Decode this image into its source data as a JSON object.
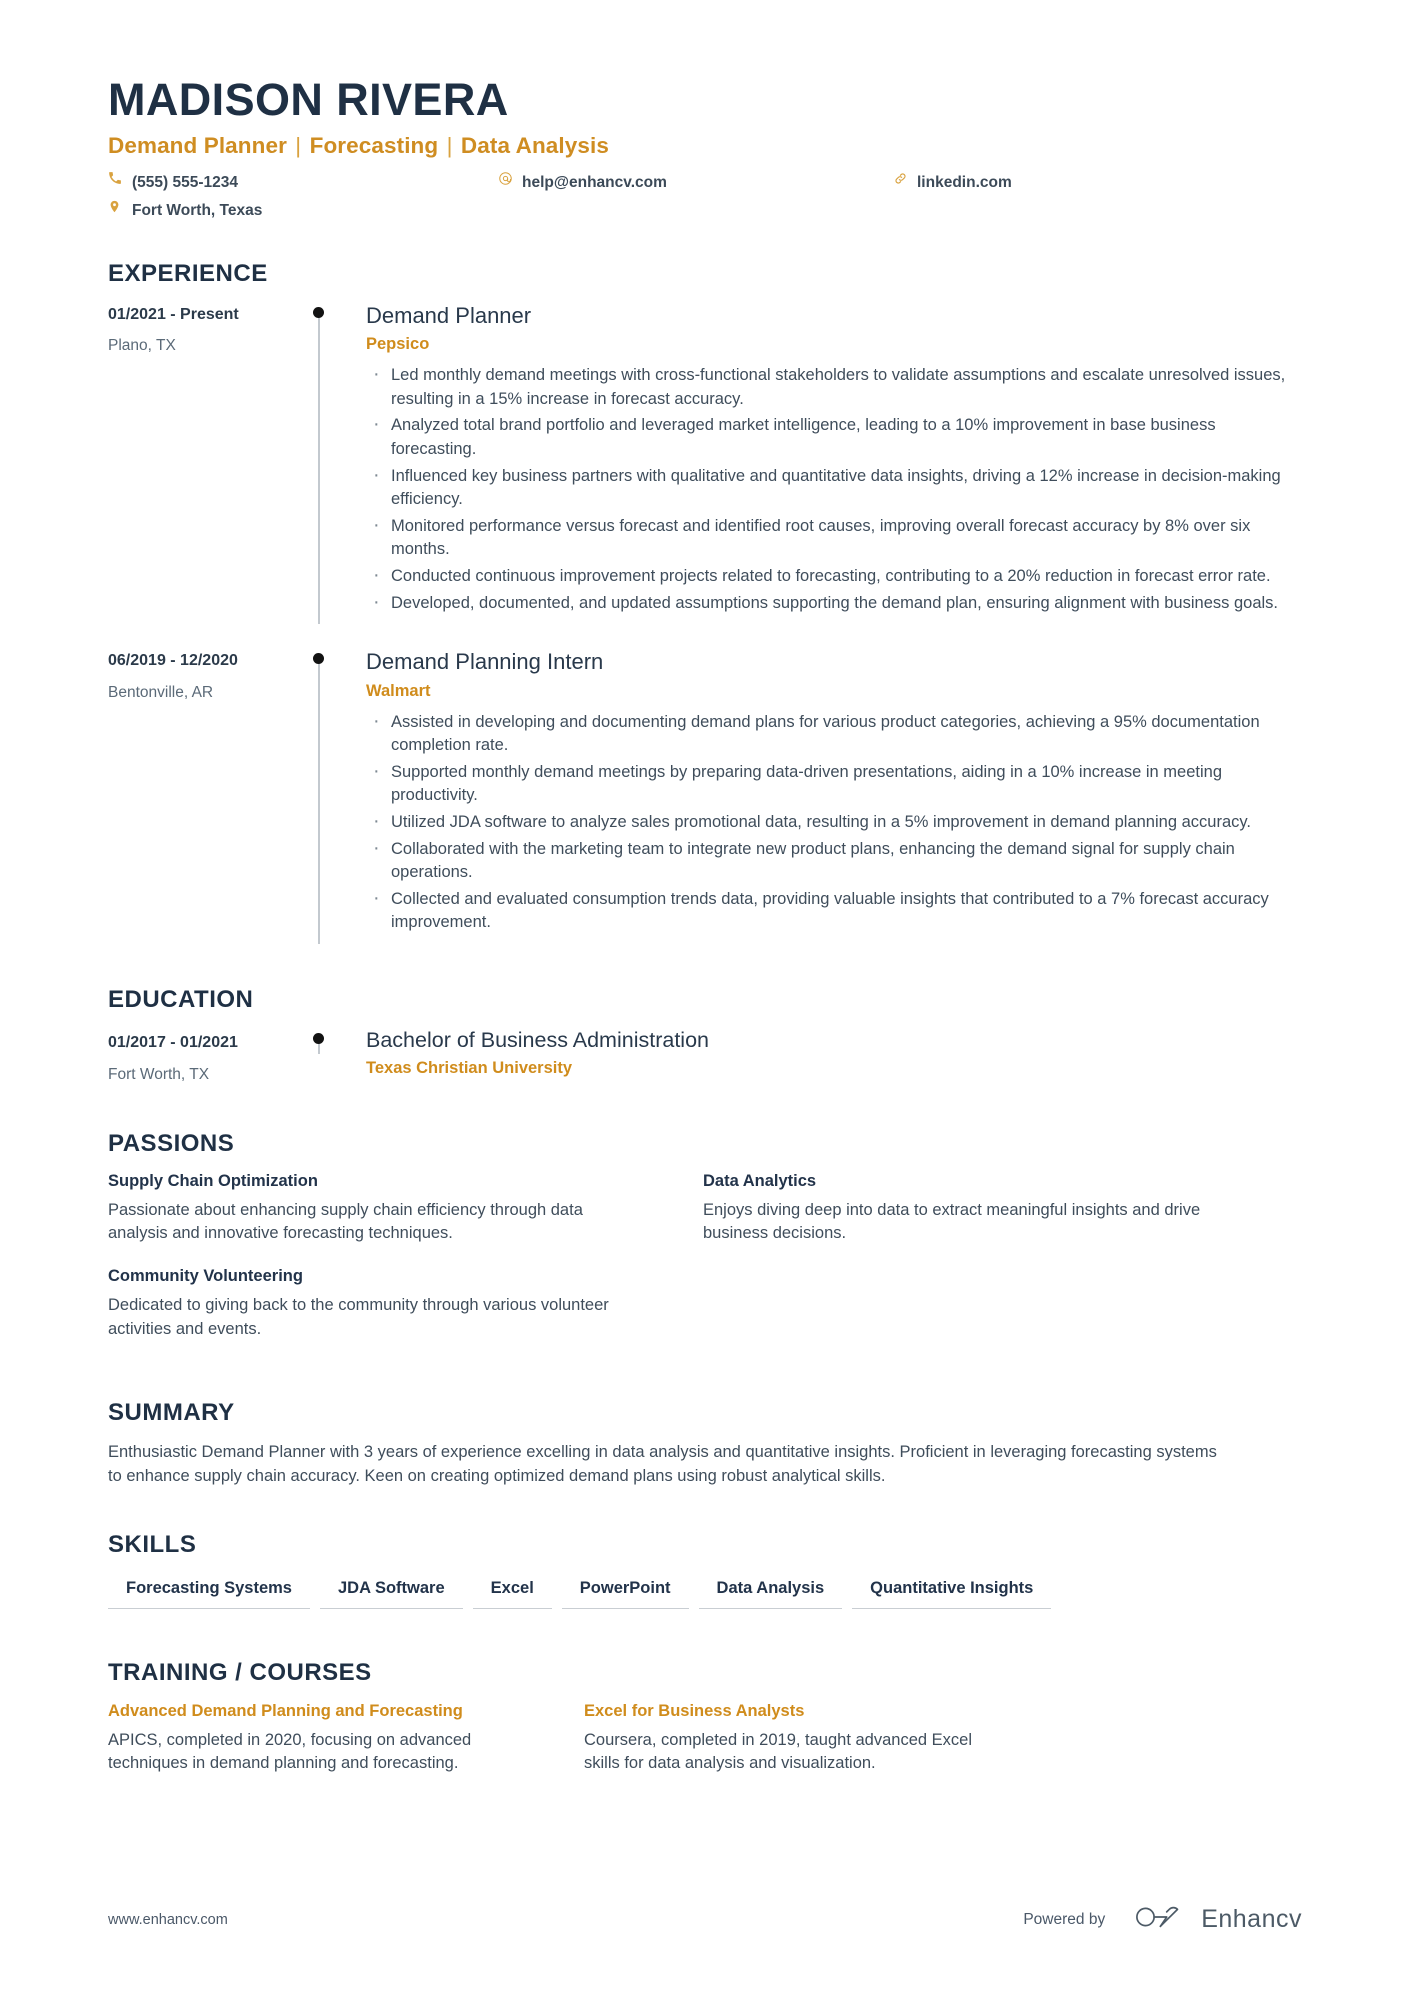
{
  "header": {
    "name": "MADISON RIVERA",
    "headline_parts": [
      "Demand Planner",
      "Forecasting",
      "Data Analysis"
    ],
    "headline": "Demand Planner | Forecasting | Data Analysis",
    "contacts": [
      {
        "icon": "phone-icon",
        "value": "(555) 555-1234"
      },
      {
        "icon": "email-icon",
        "value": "help@enhancv.com"
      },
      {
        "icon": "link-icon",
        "value": "linkedin.com"
      },
      {
        "icon": "location-icon",
        "value": "Fort Worth, Texas"
      }
    ]
  },
  "sections": {
    "experience": {
      "title": "EXPERIENCE",
      "entries": [
        {
          "date": "01/2021 - Present",
          "location": "Plano, TX",
          "role": "Demand Planner",
          "company": "Pepsico",
          "bullets": [
            "Led monthly demand meetings with cross-functional stakeholders to validate assumptions and escalate unresolved issues, resulting in a 15% increase in forecast accuracy.",
            "Analyzed total brand portfolio and leveraged market intelligence, leading to a 10% improvement in base business forecasting.",
            "Influenced key business partners with qualitative and quantitative data insights, driving a 12% increase in decision-making efficiency.",
            "Monitored performance versus forecast and identified root causes, improving overall forecast accuracy by 8% over six months.",
            "Conducted continuous improvement projects related to forecasting, contributing to a 20% reduction in forecast error rate.",
            "Developed, documented, and updated assumptions supporting the demand plan, ensuring alignment with business goals."
          ]
        },
        {
          "date": "06/2019 - 12/2020",
          "location": "Bentonville, AR",
          "role": "Demand Planning Intern",
          "company": "Walmart",
          "bullets": [
            "Assisted in developing and documenting demand plans for various product categories, achieving a 95% documentation completion rate.",
            "Supported monthly demand meetings by preparing data-driven presentations, aiding in a 10% increase in meeting productivity.",
            "Utilized JDA software to analyze sales promotional data, resulting in a 5% improvement in demand planning accuracy.",
            "Collaborated with the marketing team to integrate new product plans, enhancing the demand signal for supply chain operations.",
            "Collected and evaluated consumption trends data, providing valuable insights that contributed to a 7% forecast accuracy improvement."
          ]
        }
      ]
    },
    "education": {
      "title": "EDUCATION",
      "entries": [
        {
          "date": "01/2017 - 01/2021",
          "location": "Fort Worth, TX",
          "degree": "Bachelor of Business Administration",
          "school": "Texas Christian University"
        }
      ]
    },
    "passions": {
      "title": "PASSIONS",
      "items": [
        {
          "title": "Supply Chain Optimization",
          "text": "Passionate about enhancing supply chain efficiency through data analysis and innovative forecasting techniques."
        },
        {
          "title": "Data Analytics",
          "text": "Enjoys diving deep into data to extract meaningful insights and drive business decisions."
        },
        {
          "title": "Community Volunteering",
          "text": "Dedicated to giving back to the community through various volunteer activities and events."
        }
      ]
    },
    "summary": {
      "title": "SUMMARY",
      "text": "Enthusiastic Demand Planner with 3 years of experience excelling in data analysis and quantitative insights. Proficient in leveraging forecasting systems to enhance supply chain accuracy. Keen on creating optimized demand plans using robust analytical skills."
    },
    "skills": {
      "title": "SKILLS",
      "items": [
        "Forecasting Systems",
        "JDA Software",
        "Excel",
        "PowerPoint",
        "Data Analysis",
        "Quantitative Insights"
      ]
    },
    "courses": {
      "title": "TRAINING / COURSES",
      "items": [
        {
          "title": "Advanced Demand Planning and Forecasting",
          "text": "APICS, completed in 2020, focusing on advanced techniques in demand planning and forecasting."
        },
        {
          "title": "Excel for Business Analysts",
          "text": "Coursera, completed in 2019, taught advanced Excel skills for data analysis and visualization."
        }
      ]
    }
  },
  "footer": {
    "url": "www.enhancv.com",
    "powered_label": "Powered by",
    "brand": "Enhancv"
  },
  "colors": {
    "accent": "#d08c1c",
    "heading": "#1f3044",
    "body": "#3f4d5b"
  }
}
